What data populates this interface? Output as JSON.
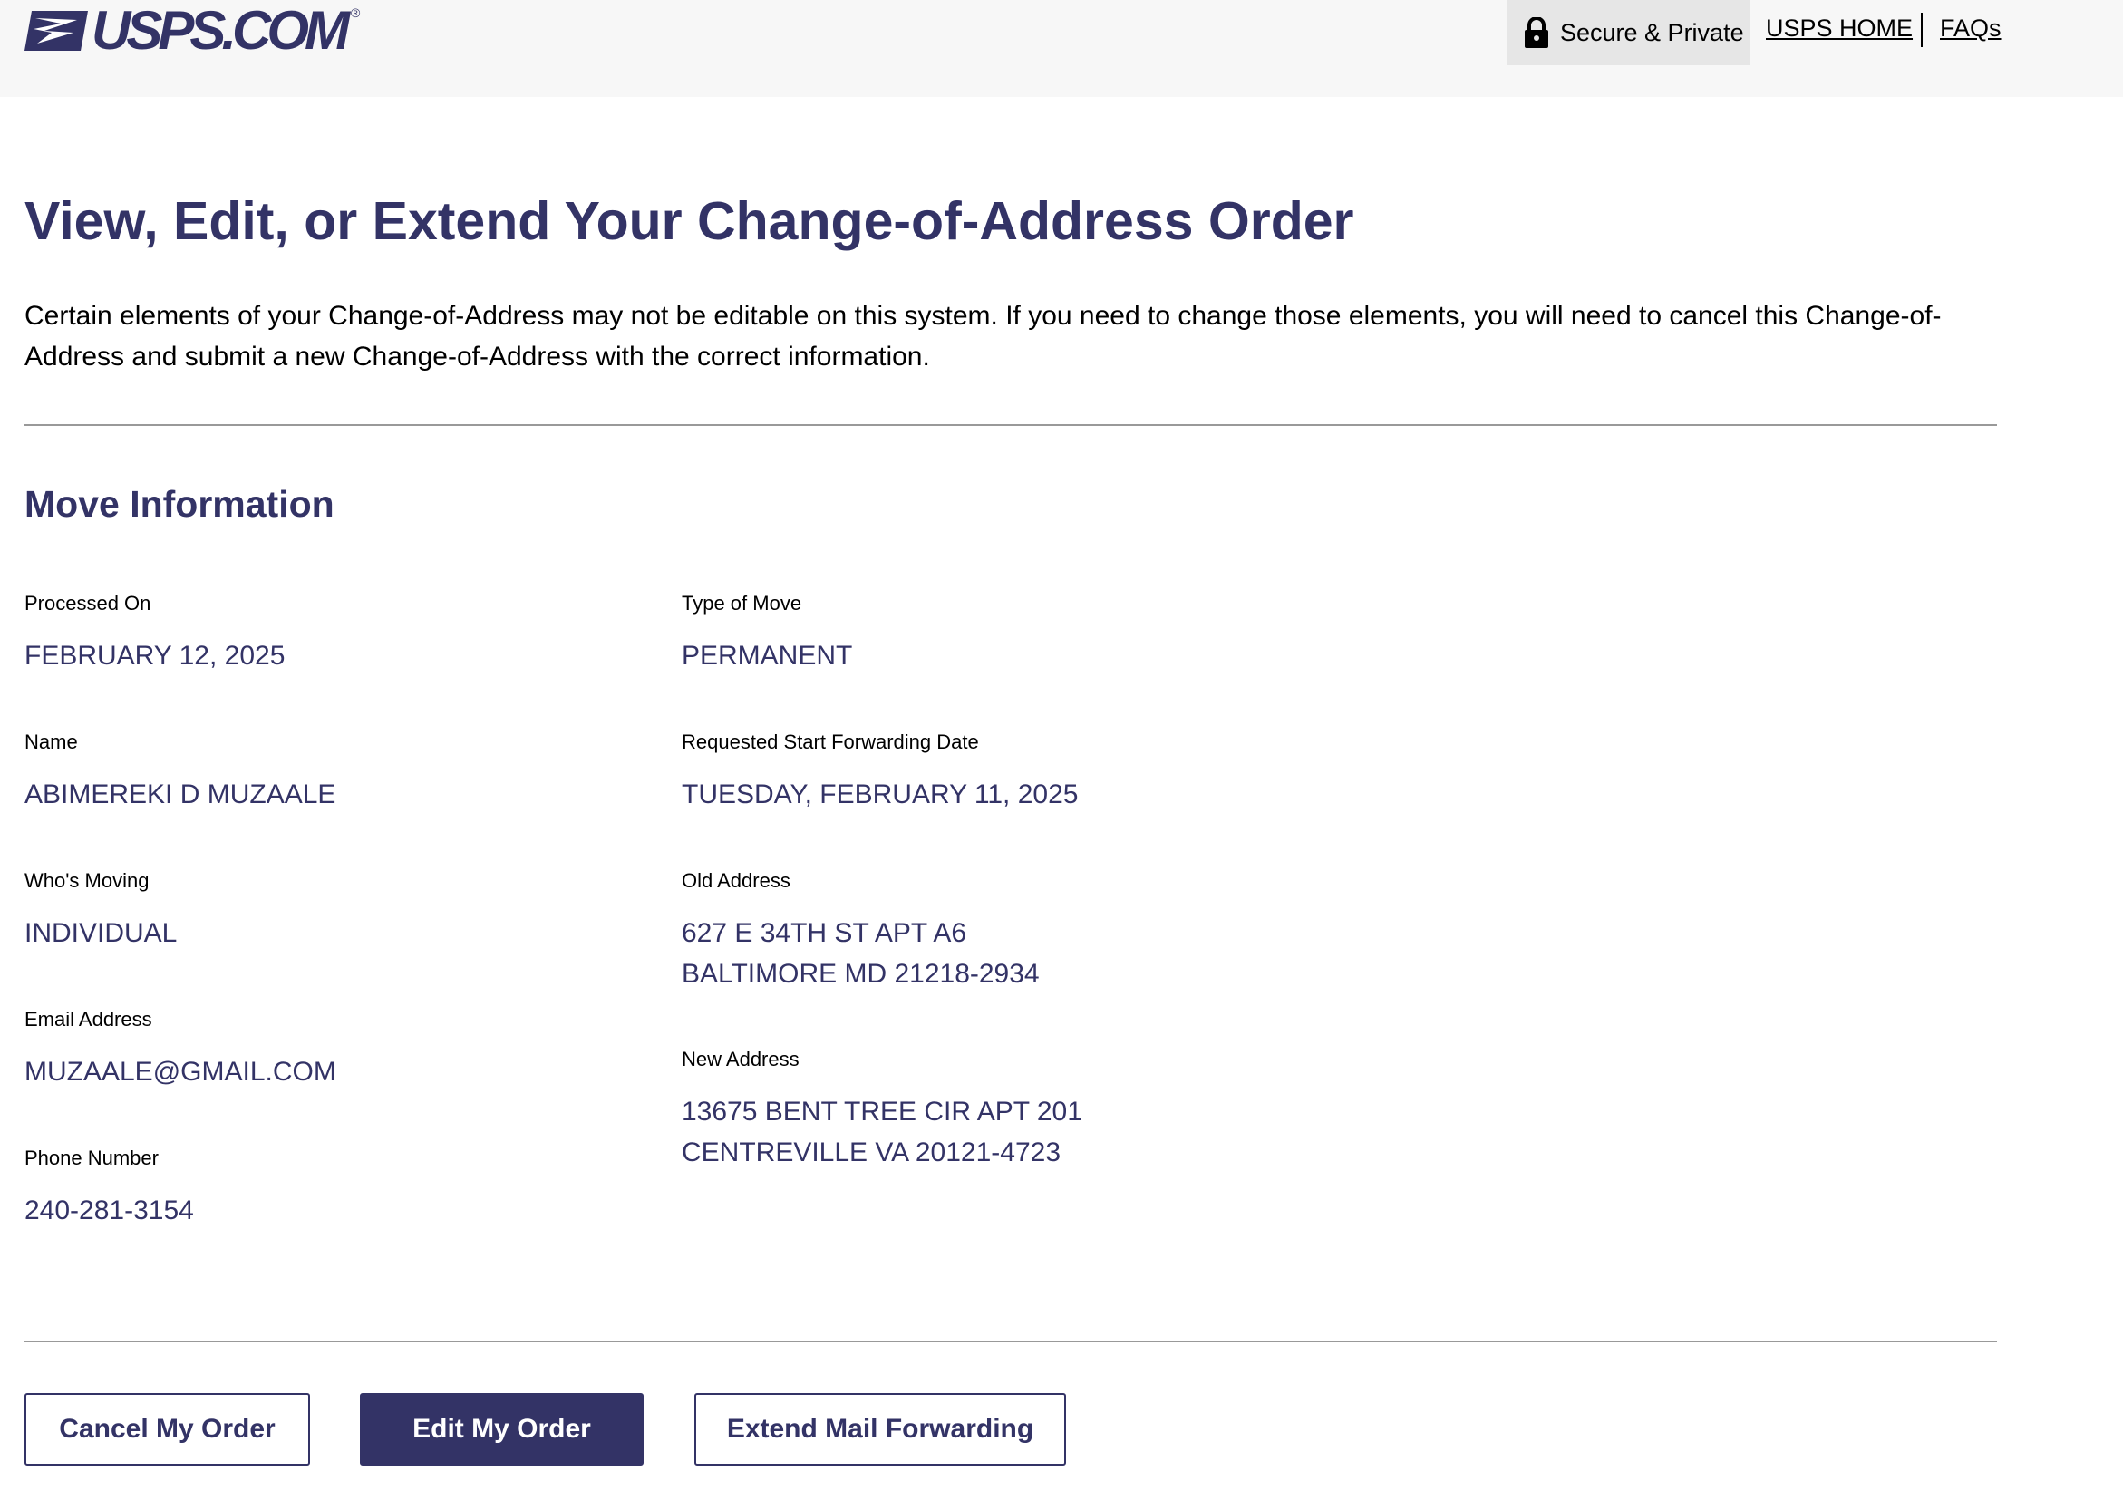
{
  "header": {
    "logo_text": "USPS.COM",
    "logo_reg": "®",
    "secure_label": "Secure & Private",
    "nav_home": "USPS HOME",
    "nav_faqs": "FAQs"
  },
  "page": {
    "title": "View, Edit, or Extend Your Change-of-Address Order",
    "intro": "Certain elements of your Change-of-Address may not be editable on this system. If you need to change those elements, you will need to cancel this Change-of-Address and submit a new Change-of-Address with the correct information."
  },
  "move": {
    "section_title": "Move Information",
    "processed_on": {
      "label": "Processed On",
      "value": "FEBRUARY 12, 2025"
    },
    "type_of_move": {
      "label": "Type of Move",
      "value": "PERMANENT"
    },
    "name": {
      "label": "Name",
      "value": "ABIMEREKI D MUZAALE"
    },
    "start_date": {
      "label": "Requested Start Forwarding Date",
      "value": "TUESDAY, FEBRUARY 11, 2025"
    },
    "whos_moving": {
      "label": "Who's Moving",
      "value": "INDIVIDUAL"
    },
    "old_address": {
      "label": "Old Address",
      "line1": "627 E 34TH ST APT A6",
      "line2": "BALTIMORE MD 21218-2934"
    },
    "email": {
      "label": "Email Address",
      "value": "MUZAALE@GMAIL.COM"
    },
    "new_address": {
      "label": "New Address",
      "line1": "13675 BENT TREE CIR APT 201",
      "line2": "CENTREVILLE VA 20121-4723"
    },
    "phone": {
      "label": "Phone Number",
      "value": "240-281-3154"
    }
  },
  "actions": {
    "cancel": "Cancel My Order",
    "edit": "Edit My Order",
    "extend": "Extend Mail Forwarding"
  },
  "colors": {
    "brand": "#333366",
    "header_bg": "#f7f7f7",
    "secure_bg": "#e6e6e6"
  }
}
